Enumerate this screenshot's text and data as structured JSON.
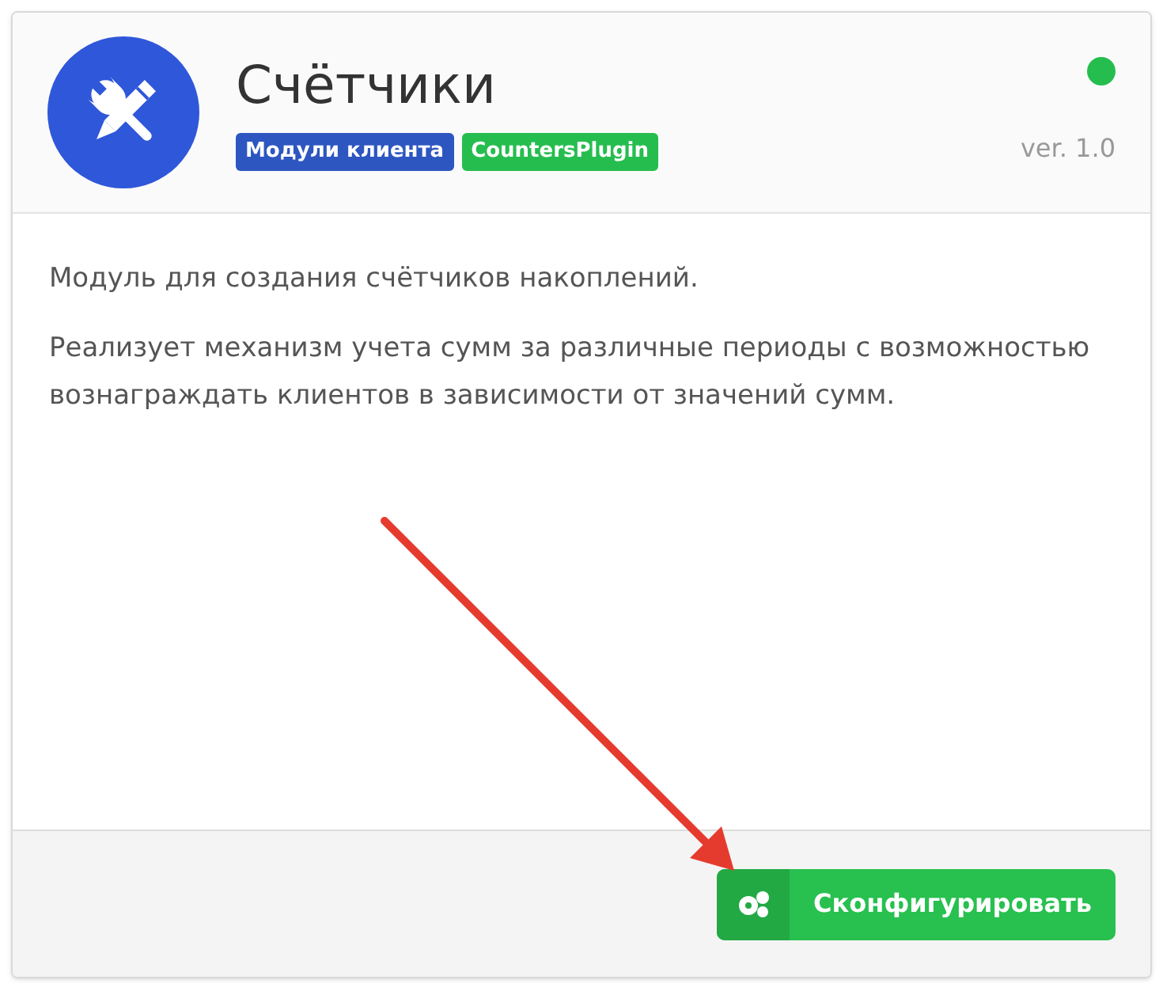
{
  "plugin": {
    "title": "Счётчики",
    "status": {
      "color": "#26bd4f"
    },
    "version": "ver. 1.0",
    "tags": [
      {
        "label": "Модули клиента",
        "color": "#2d56c0"
      },
      {
        "label": "CountersPlugin",
        "color": "#26bd4f"
      }
    ]
  },
  "description": [
    "Модуль для создания счётчиков накоплений.",
    "Реализует механизм учета сумм за различные периоды с возможностью вознаграждать клиентов в зависимости от значений сумм."
  ],
  "footer": {
    "button": "Сконфигурировать"
  }
}
